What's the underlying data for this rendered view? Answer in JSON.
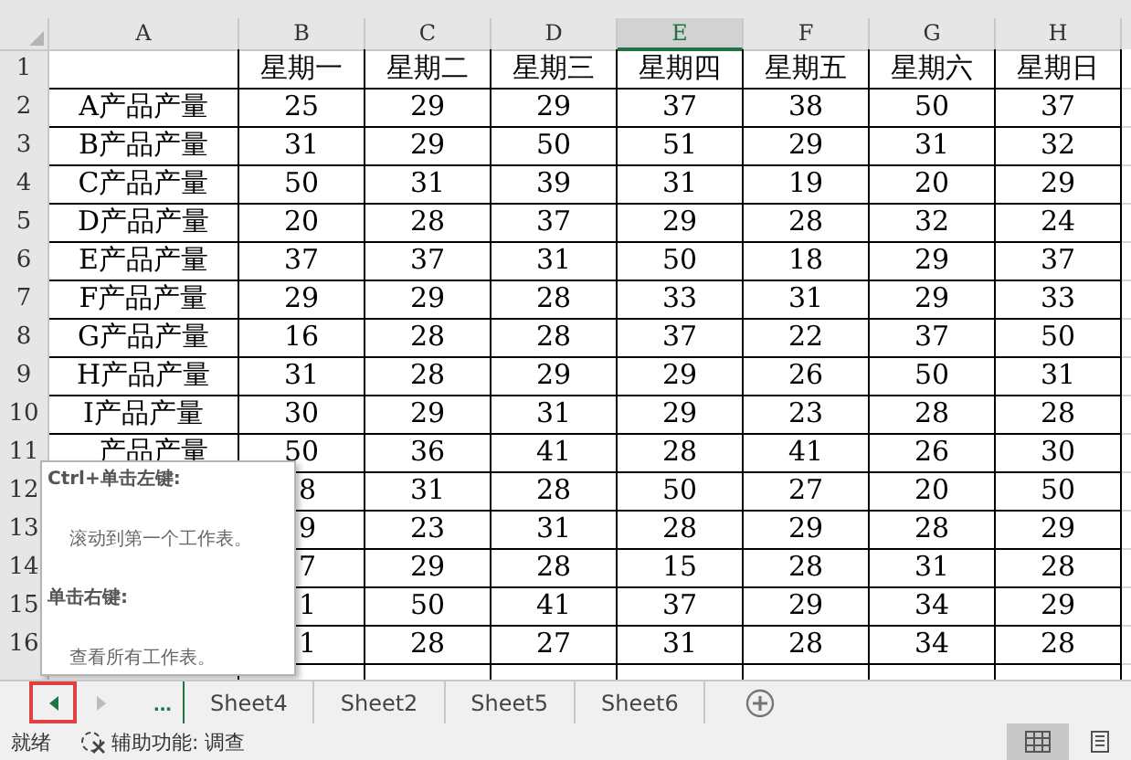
{
  "columns": [
    {
      "label": "A",
      "selected": false
    },
    {
      "label": "B",
      "selected": false
    },
    {
      "label": "C",
      "selected": false
    },
    {
      "label": "D",
      "selected": false
    },
    {
      "label": "E",
      "selected": true
    },
    {
      "label": "F",
      "selected": false
    },
    {
      "label": "G",
      "selected": false
    },
    {
      "label": "H",
      "selected": false
    }
  ],
  "rows": [
    {
      "number": "1",
      "cells": [
        null,
        "星期一",
        "星期二",
        "星期三",
        "星期四",
        "星期五",
        "星期六",
        "星期日"
      ]
    },
    {
      "number": "2",
      "cells": [
        "A产品产量",
        "25",
        "29",
        "29",
        "37",
        "38",
        "50",
        "37"
      ]
    },
    {
      "number": "3",
      "cells": [
        "B产品产量",
        "31",
        "29",
        "50",
        "51",
        "29",
        "31",
        "32"
      ]
    },
    {
      "number": "4",
      "cells": [
        "C产品产量",
        "50",
        "31",
        "39",
        "31",
        "19",
        "20",
        "29"
      ]
    },
    {
      "number": "5",
      "cells": [
        "D产品产量",
        "20",
        "28",
        "37",
        "29",
        "28",
        "32",
        "24"
      ]
    },
    {
      "number": "6",
      "cells": [
        "E产品产量",
        "37",
        "37",
        "31",
        "50",
        "18",
        "29",
        "37"
      ]
    },
    {
      "number": "7",
      "cells": [
        "F产品产量",
        "29",
        "29",
        "28",
        "33",
        "31",
        "29",
        "33"
      ]
    },
    {
      "number": "8",
      "cells": [
        "G产品产量",
        "16",
        "28",
        "28",
        "37",
        "22",
        "37",
        "50"
      ]
    },
    {
      "number": "9",
      "cells": [
        "H产品产量",
        "31",
        "28",
        "29",
        "29",
        "26",
        "50",
        "31"
      ]
    },
    {
      "number": "10",
      "cells": [
        "I产品产量",
        "30",
        "29",
        "31",
        "29",
        "23",
        "28",
        "28"
      ]
    },
    {
      "number": "11",
      "cells": [
        {
          "text": "产品产量",
          "clipped": true
        },
        "50",
        "36",
        "41",
        "28",
        "41",
        "26",
        "30"
      ]
    },
    {
      "number": "12",
      "cells": [
        null,
        {
          "text": "8",
          "clipped": true
        },
        "31",
        "28",
        "50",
        "27",
        "20",
        "50"
      ]
    },
    {
      "number": "13",
      "cells": [
        null,
        {
          "text": "9",
          "clipped": true
        },
        "23",
        "31",
        "28",
        "29",
        "28",
        "29"
      ]
    },
    {
      "number": "14",
      "cells": [
        null,
        {
          "text": "7",
          "clipped": true
        },
        "29",
        "28",
        "15",
        "28",
        "31",
        "28"
      ]
    },
    {
      "number": "15",
      "cells": [
        null,
        {
          "text": "1",
          "clipped": true
        },
        "50",
        "41",
        "37",
        "29",
        "34",
        "29"
      ]
    },
    {
      "number": "16",
      "cells": [
        null,
        {
          "text": "1",
          "clipped": true
        },
        "28",
        "27",
        "31",
        "28",
        "34",
        "28"
      ]
    }
  ],
  "tooltip": {
    "lines": [
      {
        "kind": "heading",
        "text": "Ctrl+单击左键:"
      },
      {
        "kind": "body",
        "text": "滚动到第一个工作表。"
      },
      {
        "kind": "heading",
        "text": "单击右键:"
      },
      {
        "kind": "body",
        "text": "查看所有工作表。"
      }
    ]
  },
  "sheet_nav": [
    {
      "kind": "prev",
      "disabled": false,
      "highlighted": true
    },
    {
      "kind": "next",
      "disabled": true,
      "highlighted": false
    }
  ],
  "more_sheets": "...",
  "sheet_tabs": [
    {
      "label": "Sheet4",
      "selected": false
    },
    {
      "label": "Sheet2",
      "selected": false
    },
    {
      "label": "Sheet5",
      "selected": false
    },
    {
      "label": "Sheet6",
      "selected": false
    }
  ],
  "status_bar": {
    "status": "就绪",
    "accessibility": "辅助功能: 调查",
    "views": [
      {
        "kind": "normal",
        "selected": true
      },
      {
        "kind": "page_layout",
        "selected": false
      }
    ]
  }
}
